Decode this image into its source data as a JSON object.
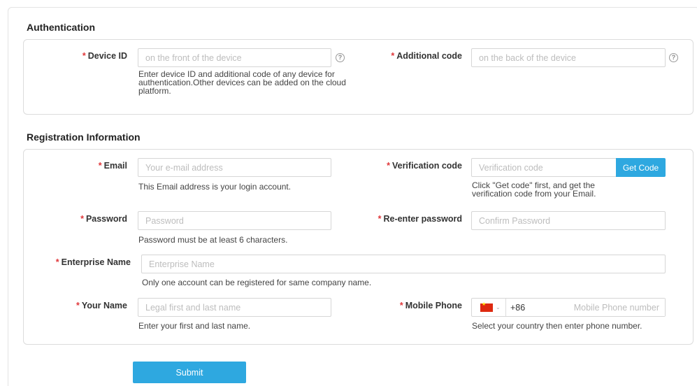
{
  "authentication": {
    "title": "Authentication",
    "device_id": {
      "label": "Device ID",
      "placeholder": "on the front of the device",
      "value": ""
    },
    "additional_code": {
      "label": "Additional code",
      "placeholder": "on the back of the device",
      "value": ""
    },
    "help_icon": "?",
    "hint": [
      "Enter device ID and additional code of any device for",
      "authentication.Other devices can be added on the cloud",
      "platform."
    ]
  },
  "registration": {
    "title": "Registration Information",
    "email": {
      "label": "Email",
      "placeholder": "Your e-mail address",
      "hint": "This Email address is your login account."
    },
    "verification": {
      "label": "Verification code",
      "placeholder": "Verification code",
      "button": "Get Code",
      "hint": [
        "Click \"Get code\" first, and get the",
        "verification code from your Email."
      ]
    },
    "password": {
      "label": "Password",
      "placeholder": "Password",
      "hint": "Password must be at least 6 characters."
    },
    "reenter_password": {
      "label": "Re-enter password",
      "placeholder": "Confirm Password"
    },
    "enterprise": {
      "label": "Enterprise Name",
      "placeholder": "Enterprise Name",
      "hint": "Only one account can be registered for same company name."
    },
    "your_name": {
      "label": "Your Name",
      "placeholder": "Legal first and last name",
      "hint": "Enter your first and last name."
    },
    "mobile": {
      "label": "Mobile Phone",
      "country_flag": "china-flag-icon",
      "dial_code": "+86",
      "placeholder": "Mobile Phone number",
      "hint": "Select your country then enter phone number."
    }
  },
  "required_mark": "*",
  "submit_label": "Submit",
  "colors": {
    "accent": "#2ea8e0",
    "required": "#e0373a"
  }
}
